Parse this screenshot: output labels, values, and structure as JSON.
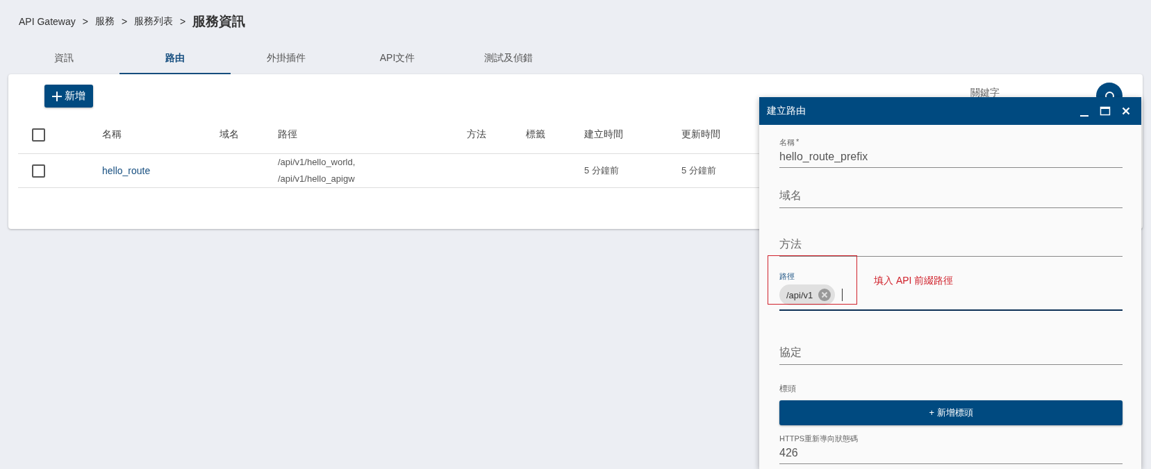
{
  "breadcrumb": {
    "separator": ">",
    "items": [
      "API Gateway",
      "服務",
      "服務列表"
    ],
    "current": "服務資訊"
  },
  "tabs": [
    {
      "label": "資訊",
      "selected": false
    },
    {
      "label": "路由",
      "selected": true
    },
    {
      "label": "外掛插件",
      "selected": false
    },
    {
      "label": "API文件",
      "selected": false
    },
    {
      "label": "測試及偵錯",
      "selected": false
    }
  ],
  "add_button": "新增",
  "search": {
    "label": "關鍵字"
  },
  "table": {
    "columns": [
      "名稱",
      "域名",
      "路徑",
      "方法",
      "標籤",
      "建立時間",
      "更新時間"
    ],
    "all_checked": false,
    "rows": [
      {
        "checked": false,
        "name": "hello_route",
        "paths": [
          "/api/v1/hello_world,",
          "/api/v1/hello_apigw"
        ],
        "created": "5 分鐘前",
        "updated": "5 分鐘前"
      }
    ]
  },
  "dialog": {
    "title": "建立路由",
    "fields": [
      {
        "kind": "text",
        "label": "名稱",
        "required_mark": "*",
        "value": "hello_route_prefix",
        "focused": false
      },
      {
        "kind": "text",
        "label": "域名",
        "focused": false
      },
      {
        "kind": "text",
        "label": "方法",
        "focused": false
      },
      {
        "kind": "chips",
        "label": "路徑",
        "chips": [
          "/api/v1"
        ],
        "focused": true,
        "annotation": "填入 API 前綴路徑"
      },
      {
        "kind": "text",
        "label": "協定",
        "focused": false
      },
      {
        "kind": "button",
        "label": "標頭",
        "button": "+ 新增標頭"
      },
      {
        "kind": "text",
        "label": "HTTPS重新導向狀態碼",
        "value": "426",
        "focused": false
      }
    ]
  }
}
